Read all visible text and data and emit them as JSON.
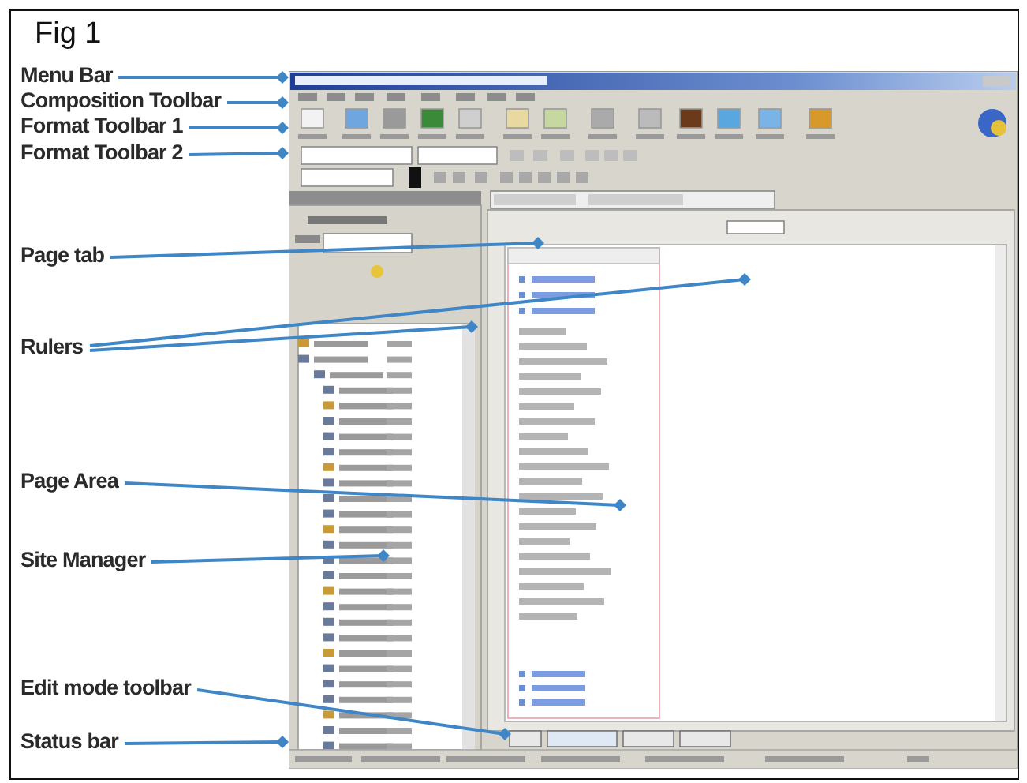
{
  "figure": {
    "title": "Fig 1"
  },
  "callouts": [
    {
      "label": "Menu Bar"
    },
    {
      "label": "Composition Toolbar"
    },
    {
      "label": "Format Toolbar 1"
    },
    {
      "label": "Format Toolbar 2"
    },
    {
      "label": "Page tab"
    },
    {
      "label": "Rulers"
    },
    {
      "label": "Page Area"
    },
    {
      "label": "Site Manager"
    },
    {
      "label": "Edit mode toolbar"
    },
    {
      "label": "Status bar"
    }
  ]
}
